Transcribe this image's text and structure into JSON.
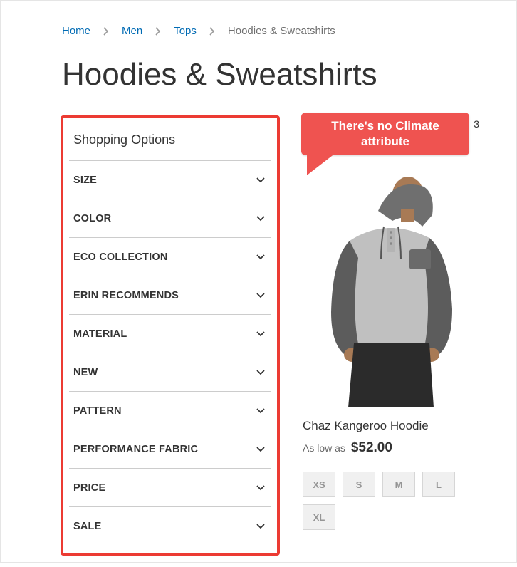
{
  "breadcrumb": {
    "items": [
      {
        "label": "Home",
        "link": true
      },
      {
        "label": "Men",
        "link": true
      },
      {
        "label": "Tops",
        "link": true
      },
      {
        "label": "Hoodies & Sweatshirts",
        "link": false
      }
    ]
  },
  "page_title": "Hoodies & Sweatshirts",
  "filter": {
    "title": "Shopping Options",
    "options": [
      "SIZE",
      "COLOR",
      "ECO COLLECTION",
      "ERIN RECOMMENDS",
      "MATERIAL",
      "NEW",
      "PATTERN",
      "PERFORMANCE FABRIC",
      "PRICE",
      "SALE"
    ]
  },
  "callout": {
    "text": "There's no Climate attribute",
    "color": "#ef5350"
  },
  "count_fragment": "3",
  "product": {
    "name": "Chaz Kangeroo Hoodie",
    "price_prefix": "As low as",
    "price": "$52.00",
    "sizes": [
      "XS",
      "S",
      "M",
      "L",
      "XL"
    ]
  }
}
